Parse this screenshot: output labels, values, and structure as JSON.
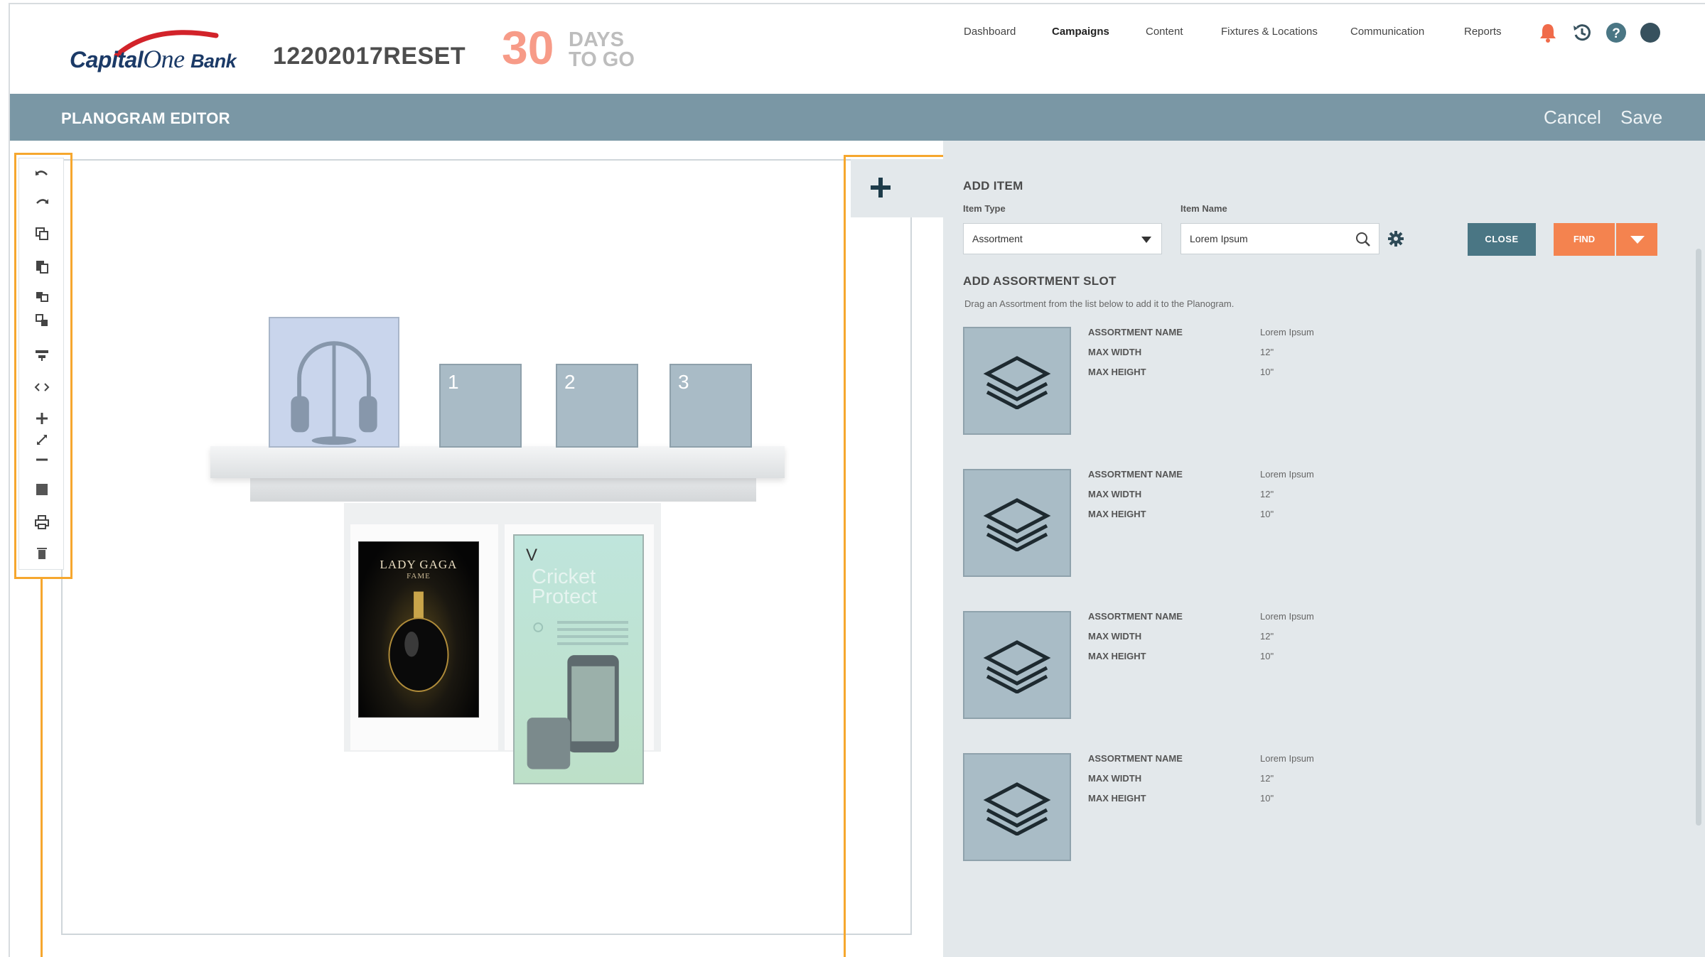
{
  "brand": {
    "logo_main": "Capital",
    "logo_one": "One",
    "logo_bank": "Bank",
    "campaign_id": "12202017RESET",
    "days_count": "30",
    "days_label_1": "DAYS",
    "days_label_2": "TO GO"
  },
  "nav": {
    "items": [
      "Dashboard",
      "Campaigns",
      "Content",
      "Fixtures & Locations",
      "Communication",
      "Reports"
    ],
    "active": "Campaigns"
  },
  "header_icons": [
    "bell-icon",
    "history-icon",
    "help-icon",
    "avatar"
  ],
  "titlebar": {
    "title": "PLANOGRAM EDITOR",
    "cancel": "Cancel",
    "save": "Save"
  },
  "toolbar": {
    "tools": [
      "undo-icon",
      "redo-icon",
      "copy-icon",
      "paste-icon",
      "duplicate-icon",
      "align-icon",
      "code-icon",
      "zoom-icon",
      "fill-icon",
      "print-icon",
      "delete-icon"
    ]
  },
  "canvas": {
    "slots": [
      "1",
      "2",
      "3"
    ],
    "poster1_title": "LADY GAGA",
    "poster1_sub": "FAME",
    "poster2_letter": "V",
    "poster2_title_1": "Cricket",
    "poster2_title_2": "Protect"
  },
  "panel": {
    "add_item": "ADD ITEM",
    "item_type_label": "Item Type",
    "item_name_label": "Item Name",
    "item_type_value": "Assortment",
    "item_name_value": "Lorem Ipsum",
    "close": "CLOSE",
    "find": "FIND",
    "slot_heading": "ADD ASSORTMENT SLOT",
    "slot_hint": "Drag an Assortment from the list below to add it to the Planogram.",
    "field_labels": [
      "ASSORTMENT NAME",
      "MAX WIDTH",
      "MAX HEIGHT"
    ],
    "assortments": [
      {
        "name": "Lorem Ipsum",
        "max_width": "12\"",
        "max_height": "10\""
      },
      {
        "name": "Lorem Ipsum",
        "max_width": "12\"",
        "max_height": "10\""
      },
      {
        "name": "Lorem Ipsum",
        "max_width": "12\"",
        "max_height": "10\""
      },
      {
        "name": "Lorem Ipsum",
        "max_width": "12\"",
        "max_height": "10\""
      }
    ]
  },
  "colors": {
    "titlebar": "#7a97a5",
    "accent_orange": "#f6a72e",
    "find_button": "#f4834f",
    "close_button": "#4a7684",
    "days_number": "#f79b88"
  }
}
